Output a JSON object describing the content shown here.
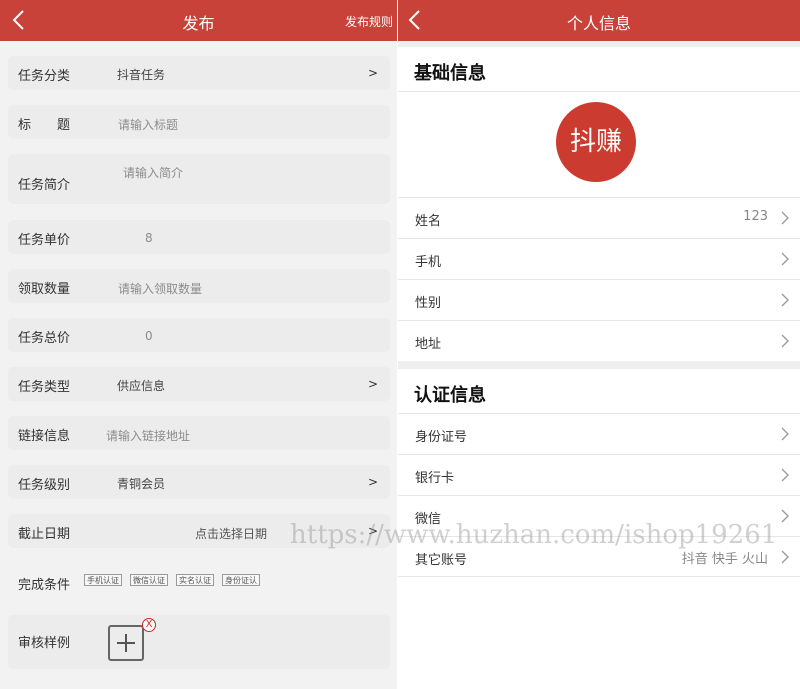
{
  "left": {
    "title": "发布",
    "rule_link": "发布规则",
    "fields": {
      "category": {
        "label": "任务分类",
        "value": "抖音任务",
        "arrow": ">"
      },
      "title": {
        "label": "标　　题",
        "placeholder": "请输入标题"
      },
      "intro": {
        "label": "任务简介",
        "placeholder": "请输入简介"
      },
      "unit_price": {
        "label": "任务单价",
        "value": "8"
      },
      "quantity": {
        "label": "领取数量",
        "placeholder": "请输入领取数量"
      },
      "total_price": {
        "label": "任务总价",
        "value": "0"
      },
      "type": {
        "label": "任务类型",
        "value": "供应信息",
        "arrow": ">"
      },
      "link": {
        "label": "链接信息",
        "placeholder": "请输入链接地址"
      },
      "level": {
        "label": "任务级别",
        "value": "青铜会员",
        "arrow": ">"
      },
      "deadline": {
        "label": "截止日期",
        "placeholder": "点击选择日期",
        "arrow": ">"
      },
      "conditions": {
        "label": "完成条件",
        "tags": [
          "手机认证",
          "微信认证",
          "实名认证",
          "身份证认"
        ]
      },
      "sample": {
        "label": "审核样例",
        "delete_mark": "X"
      }
    }
  },
  "right": {
    "title": "个人信息",
    "basic_section": "基础信息",
    "avatar_text": "抖赚",
    "basic_rows": [
      {
        "label": "姓名",
        "value": "123"
      },
      {
        "label": "手机",
        "value": ""
      },
      {
        "label": "性别",
        "value": ""
      },
      {
        "label": "地址",
        "value": ""
      }
    ],
    "auth_section": "认证信息",
    "auth_rows": [
      {
        "label": "身份证号",
        "value": ""
      },
      {
        "label": "银行卡",
        "value": ""
      },
      {
        "label": "微信",
        "value": ""
      },
      {
        "label": "其它账号",
        "value": "抖音 快手 火山"
      }
    ]
  },
  "watermark": "https://www.huzhan.com/ishop19261",
  "colors": {
    "header": "#c8423a",
    "avatar": "#cc3b2f",
    "field_bg": "#ececec"
  }
}
